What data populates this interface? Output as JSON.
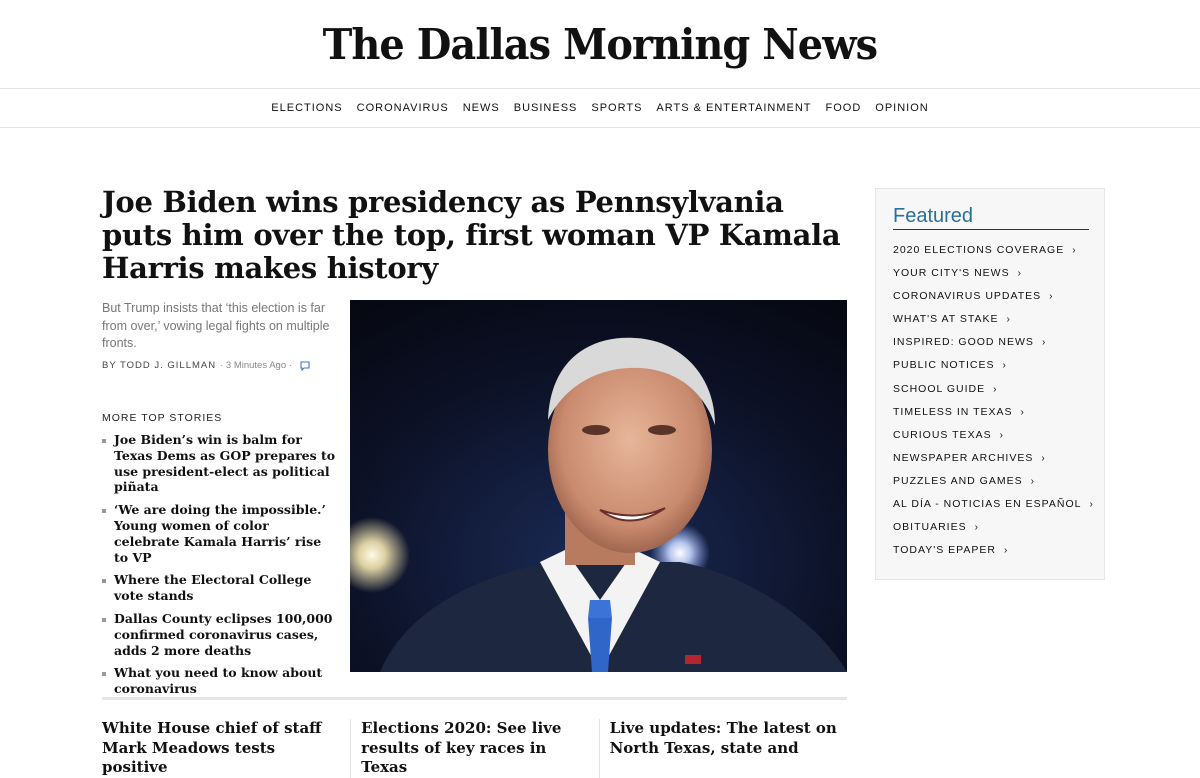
{
  "masthead": {
    "logo_text": "The Dallas Morning News"
  },
  "nav": {
    "items": [
      "ELECTIONS",
      "CORONAVIRUS",
      "NEWS",
      "BUSINESS",
      "SPORTS",
      "ARTS & ENTERTAINMENT",
      "FOOD",
      "OPINION"
    ]
  },
  "lead": {
    "headline": "Joe Biden wins presidency as Pennsylvania puts him over the top, first woman VP Kamala Harris makes history",
    "dek": "But Trump insists that ‘this election is far from over,’ vowing legal fights on multiple fronts.",
    "author": "BY TODD J. GILLMAN",
    "time": "· 3 Minutes Ago ·",
    "comment_icon": "comment-icon"
  },
  "more_top_stories": {
    "label": "MORE TOP STORIES",
    "items": [
      "Joe Biden’s win is balm for Texas Dems as GOP prepares to use president-elect as political piñata",
      "‘We are doing the impossible.’ Young women of color celebrate Kamala Harris’ rise to VP",
      "Where the Electoral College vote stands",
      "Dallas County eclipses 100,000 confirmed coronavirus cases, adds 2 more deaths",
      "What you need to know about coronavirus"
    ]
  },
  "bottom_stories": [
    "White House chief of staff Mark Meadows tests positive",
    "Elections 2020: See live results of key races in Texas",
    "Live updates: The latest on North Texas, state and"
  ],
  "featured": {
    "title": "Featured",
    "items": [
      "2020 ELECTIONS COVERAGE",
      "YOUR CITY'S NEWS",
      "CORONAVIRUS UPDATES",
      "WHAT'S AT STAKE",
      "INSPIRED: GOOD NEWS",
      "PUBLIC NOTICES",
      "SCHOOL GUIDE",
      "TIMELESS IN TEXAS",
      "CURIOUS TEXAS",
      "NEWSPAPER ARCHIVES",
      "PUZZLES AND GAMES",
      "AL DÍA - NOTICIAS EN ESPAÑOL",
      "OBITUARIES",
      "TODAY'S EPAPER"
    ],
    "chevron": "›"
  },
  "colors": {
    "featured_accent": "#2a6f9a",
    "suit": "#1e2740",
    "tie": "#2f66c8"
  }
}
